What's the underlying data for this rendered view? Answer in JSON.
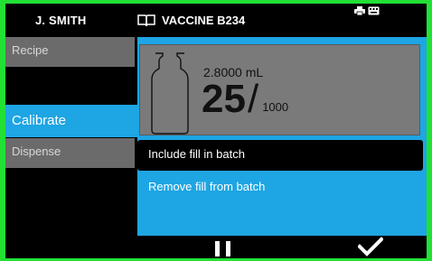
{
  "header": {
    "user": "J. SMITH",
    "batch": "VACCINE B234",
    "book_icon": "book-icon",
    "status_icons": [
      "printer-icon",
      "keyboard-icon"
    ]
  },
  "nav": {
    "items": [
      {
        "label": "Recipe",
        "selected": false
      },
      {
        "label": "Calibrate",
        "selected": true
      },
      {
        "label": "Dispense",
        "selected": false
      }
    ]
  },
  "display": {
    "volume": "2.8000 mL",
    "count": "25",
    "slash": "/",
    "total": "1000",
    "vial_icon": "vial-icon"
  },
  "options": [
    {
      "label": "Include fill in batch",
      "selected": true
    },
    {
      "label": "Remove fill from batch",
      "selected": false
    }
  ],
  "controls": {
    "pause_icon": "pause-icon",
    "confirm_icon": "checkmark-icon"
  },
  "colors": {
    "frame": "#22e034",
    "accent": "#1ea5e3",
    "nav_inactive": "#6b6b6b",
    "display_bg": "#7a7a7a"
  }
}
